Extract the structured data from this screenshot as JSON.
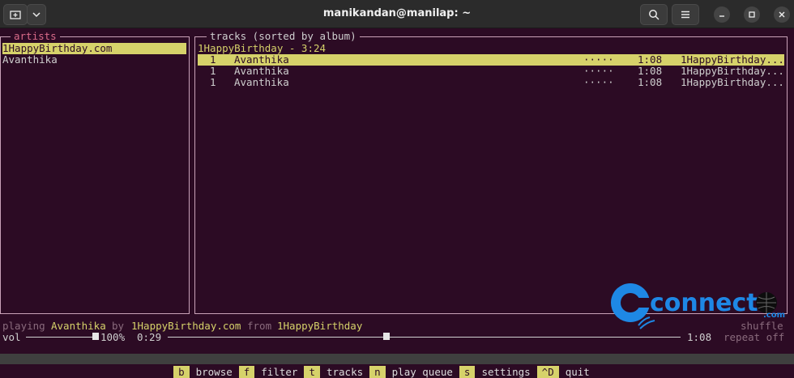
{
  "window": {
    "title": "manikandan@manilap: ~"
  },
  "titlebar": {
    "new_tab_icon": "new-tab-icon",
    "dropdown_icon": "chevron-down-icon",
    "search_icon": "search-icon",
    "menu_icon": "hamburger-icon",
    "minimize_icon": "minimize-icon",
    "maximize_icon": "maximize-icon",
    "close_icon": "close-icon"
  },
  "artists": {
    "title": "artists",
    "items": [
      "1HappyBirthday.com",
      "Avanthika"
    ]
  },
  "tracks": {
    "title": "tracks (sorted by album)",
    "album_header": "1HappyBirthday - 3:24",
    "rows": [
      {
        "num": "1",
        "title": "Avanthika",
        "rating": "·····",
        "duration": "1:08",
        "album": "1HappyBirthday..."
      },
      {
        "num": "1",
        "title": "Avanthika",
        "rating": "·····",
        "duration": "1:08",
        "album": "1HappyBirthday..."
      },
      {
        "num": "1",
        "title": "Avanthika",
        "rating": "·····",
        "duration": "1:08",
        "album": "1HappyBirthday..."
      }
    ]
  },
  "status": {
    "playing_label": "playing",
    "track": "Avanthika",
    "by_label": "by",
    "artist": "1HappyBirthday.com",
    "from_label": "from",
    "album": "1HappyBirthday",
    "shuffle": "shuffle",
    "vol_label": "vol",
    "vol_value": "100%",
    "elapsed": "0:29",
    "total": "1:08",
    "repeat": "repeat off",
    "volume_level": 1.0,
    "progress_fraction": 0.42
  },
  "keys": [
    {
      "key": "b",
      "label": "browse"
    },
    {
      "key": "f",
      "label": "filter"
    },
    {
      "key": "t",
      "label": "tracks"
    },
    {
      "key": "n",
      "label": "play queue"
    },
    {
      "key": "s",
      "label": "settings"
    },
    {
      "key": "^D",
      "label": "quit"
    }
  ],
  "watermark": {
    "text": "connect",
    "suffix": ".com"
  },
  "colors": {
    "accent": "#d6d26a",
    "background": "#2c0b24",
    "border": "#c9a2b8"
  }
}
